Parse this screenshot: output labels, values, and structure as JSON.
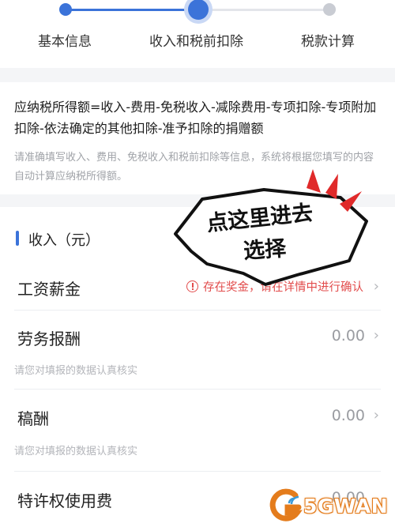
{
  "stepper": {
    "steps": [
      {
        "label": "基本信息"
      },
      {
        "label": "收入和税前扣除"
      },
      {
        "label": "税款计算"
      }
    ]
  },
  "formula": {
    "text": "应纳税所得额=收入-费用-免税收入-减除费用-专项扣除-专项附加扣除-依法确定的其他扣除-准予扣除的捐赠额",
    "hint": "请准确填写收入、费用、免税收入和税前扣除等信息，系统将根据您填写的内容自动计算应纳税所得额。"
  },
  "income": {
    "title": "收入（元）",
    "rows": [
      {
        "label": "工资薪金",
        "warning": "存在奖金，请在详情中进行确认"
      },
      {
        "label": "劳务报酬",
        "value": "0.00",
        "hint": "请您对填报的数据认真核实"
      },
      {
        "label": "稿酬",
        "value": "0.00",
        "hint": "请您对填报的数据认真核实"
      },
      {
        "label": "特许权使用费",
        "value": "0.00"
      }
    ]
  },
  "annotation": {
    "line1": "点这里进去",
    "line2": "选择"
  },
  "watermark": {
    "text": "5GWAN"
  },
  "colors": {
    "accent": "#3b73d9",
    "warning": "#e24c4c",
    "watermark": "#e47c1c"
  }
}
